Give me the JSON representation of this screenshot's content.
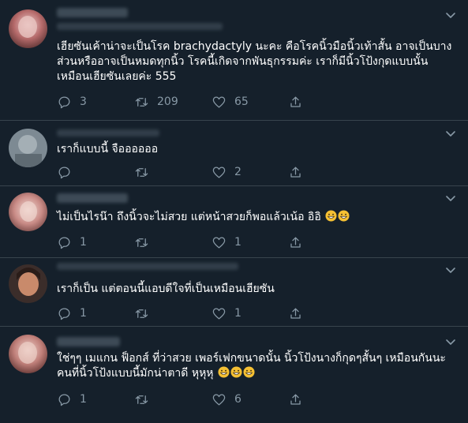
{
  "colors": {
    "background": "#15202b",
    "divider": "#38444d",
    "muted": "#8899a6",
    "text": "#ffffff",
    "emoji": "#f5c033"
  },
  "icons": {
    "reply": "speech-bubble-icon",
    "retweet": "retweet-arrows-icon",
    "like": "heart-outline-icon",
    "share": "share-upload-icon",
    "menu": "chevron-down-icon",
    "emoji": "grinning-face-emoji"
  },
  "tweets": [
    {
      "lines": [
        "เฮียซันเค้าน่าจะเป็นโรค brachydactyly นะคะ คือโรคนิ้วมือนิ้วเท้าสั้น อาจเป็นบาง",
        "ส่วนหรืออาจเป็นหมดทุกนิ้ว โรคนี้เกิดจากพันธุกรรมค่ะ เราก็มีนิ้วโป้งกุดแบบนั้น",
        "เหมือนเฮียซันเลยค่ะ 555"
      ],
      "reply_count": "3",
      "retweet_count": "209",
      "like_count": "65"
    },
    {
      "lines": [
        "เราก็แบบนี้ จืออออออ"
      ],
      "reply_count": "",
      "retweet_count": "",
      "like_count": "2"
    },
    {
      "lines": [
        "ไม่เป็นไรน๊า ถึงนิ้วจะไม่สวย แต่หน้าสวยก็พอแล้วเน้อ อิอิ"
      ],
      "emoji_count": 2,
      "reply_count": "1",
      "retweet_count": "",
      "like_count": "1"
    },
    {
      "lines": [
        "เราก็เป็น แต่ตอนนี้แอบดีใจที่เป็นเหมือนเฮียซัน"
      ],
      "reply_count": "1",
      "retweet_count": "",
      "like_count": "1"
    },
    {
      "lines": [
        "ใช่ๆๆ เมแกน ฟ็อกส์ ที่ว่าสวย เพอร์เฟกขนาดนั้น นิ้วโป้งนางก็กุดๆสั้นๆ เหมือนกันนะ",
        "คนที่นิ้วโป้งแบบนี้มักน่าตาดี หุหุหุ"
      ],
      "emoji_count": 3,
      "reply_count": "1",
      "retweet_count": "",
      "like_count": "6"
    }
  ]
}
